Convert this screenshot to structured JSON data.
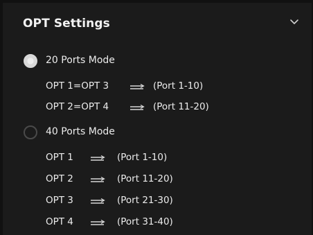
{
  "panel": {
    "title": "OPT Settings",
    "collapse_icon": "chevron-down-icon"
  },
  "modes": [
    {
      "label": "20 Ports Mode",
      "selected": true,
      "mappings": [
        {
          "opt": "OPT 1=OPT 3",
          "ports": "(Port 1-10)"
        },
        {
          "opt": "OPT 2=OPT 4",
          "ports": "(Port 11-20)"
        }
      ]
    },
    {
      "label": "40 Ports Mode",
      "selected": false,
      "mappings": [
        {
          "opt": "OPT 1",
          "ports": "(Port 1-10)"
        },
        {
          "opt": "OPT 2",
          "ports": "(Port 11-20)"
        },
        {
          "opt": "OPT 3",
          "ports": "(Port 21-30)"
        },
        {
          "opt": "OPT 4",
          "ports": "(Port 31-40)"
        }
      ]
    }
  ],
  "arrow_icon": "right-arrows-icon",
  "colors": {
    "background": "#1b1b1b",
    "text": "#ececec",
    "radio_selected": "#d9d9d9",
    "radio_unselected_border": "#4a4a4a"
  }
}
